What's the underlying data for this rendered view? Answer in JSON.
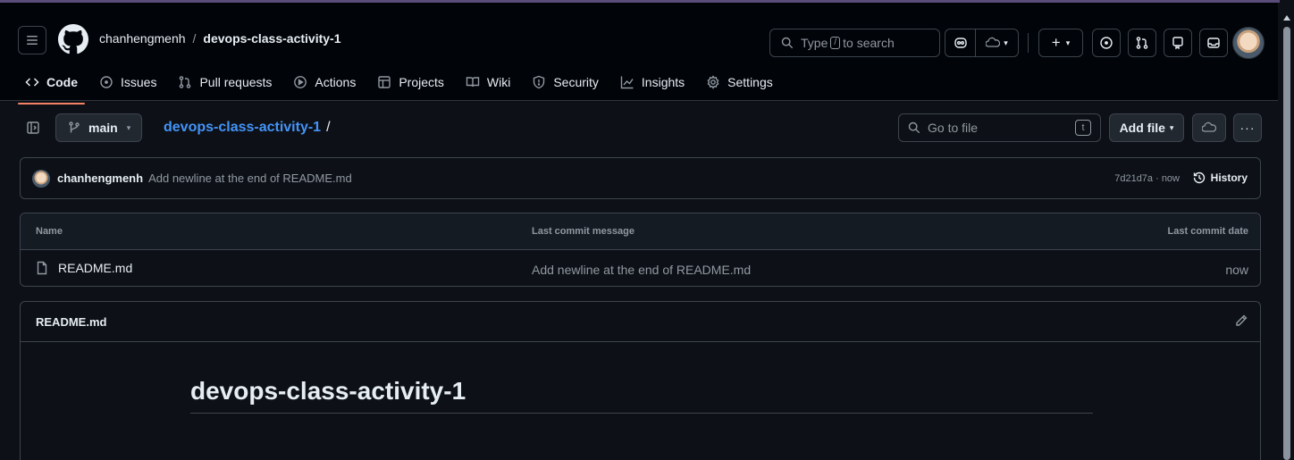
{
  "header": {
    "owner": "chanhengmenh",
    "separator": "/",
    "repo": "devops-class-activity-1",
    "search": {
      "prefix": "Type",
      "key": "/",
      "suffix": "to search"
    }
  },
  "tabs": [
    {
      "label": "Code",
      "icon": "code-icon"
    },
    {
      "label": "Issues",
      "icon": "issue-icon"
    },
    {
      "label": "Pull requests",
      "icon": "pull-request-icon"
    },
    {
      "label": "Actions",
      "icon": "play-icon"
    },
    {
      "label": "Projects",
      "icon": "table-icon"
    },
    {
      "label": "Wiki",
      "icon": "book-icon"
    },
    {
      "label": "Security",
      "icon": "shield-icon"
    },
    {
      "label": "Insights",
      "icon": "graph-icon"
    },
    {
      "label": "Settings",
      "icon": "gear-icon"
    }
  ],
  "toolbar": {
    "branch": "main",
    "path_repo": "devops-class-activity-1",
    "path_sep": "/",
    "goto_placeholder": "Go to file",
    "goto_key": "t",
    "add_file": "Add file"
  },
  "commit": {
    "author": "chanhengmenh",
    "message": "Add newline at the end of README.md",
    "meta": "7d21d7a · now",
    "history": "History"
  },
  "files": {
    "headers": {
      "name": "Name",
      "message": "Last commit message",
      "date": "Last commit date"
    },
    "rows": [
      {
        "name": "README.md",
        "message": "Add newline at the end of README.md",
        "date": "now"
      }
    ]
  },
  "readme": {
    "title": "README.md",
    "heading": "devops-class-activity-1"
  },
  "colors": {
    "accent_underline": "#f78166",
    "link": "#4493f8",
    "background": "#0d1117",
    "header_bg": "#010409"
  }
}
